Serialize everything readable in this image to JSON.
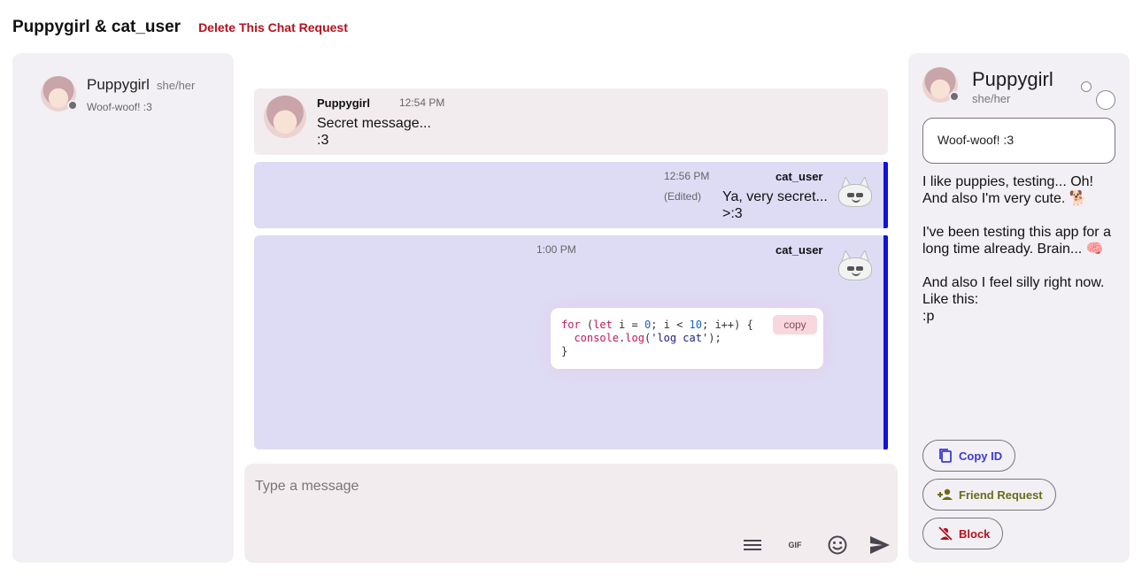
{
  "header": {
    "title": "Puppygirl & cat_user",
    "delete_label": "Delete This Chat Request"
  },
  "sidebar": {
    "items": [
      {
        "name": "Puppygirl",
        "pronouns": "she/her",
        "status": "Woof-woof! :3"
      }
    ]
  },
  "messages": [
    {
      "author": "Puppygirl",
      "time": "12:54 PM",
      "text": "Secret message...\n:3"
    },
    {
      "author": "cat_user",
      "time": "12:56 PM",
      "edited": "(Edited)",
      "text": "Ya, very secret...\n>:3"
    },
    {
      "author": "cat_user",
      "time": "1:00 PM",
      "code_copy_label": "copy"
    }
  ],
  "composer": {
    "placeholder": "Type a message",
    "tools": [
      "menu-icon",
      "gif-icon",
      "emoji-icon",
      "send-icon"
    ],
    "gif_label": "GIF"
  },
  "profile": {
    "name": "Puppygirl",
    "pronouns": "she/her",
    "status": "Woof-woof! :3",
    "bio": "I like puppies, testing... Oh!\nAnd also I'm very cute. 🐕\n\nI've been testing this app for a long time already. Brain... 🧠\n\nAnd also I feel silly right now.\nLike this:\n:p",
    "buttons": {
      "copy_id": "Copy ID",
      "friend_request": "Friend Request",
      "block": "Block"
    }
  },
  "colors": {
    "accent_blue": "#1212d8",
    "danger": "#b3121d",
    "copy_id": "#3a3ad6",
    "friend": "#6b6a1a"
  }
}
